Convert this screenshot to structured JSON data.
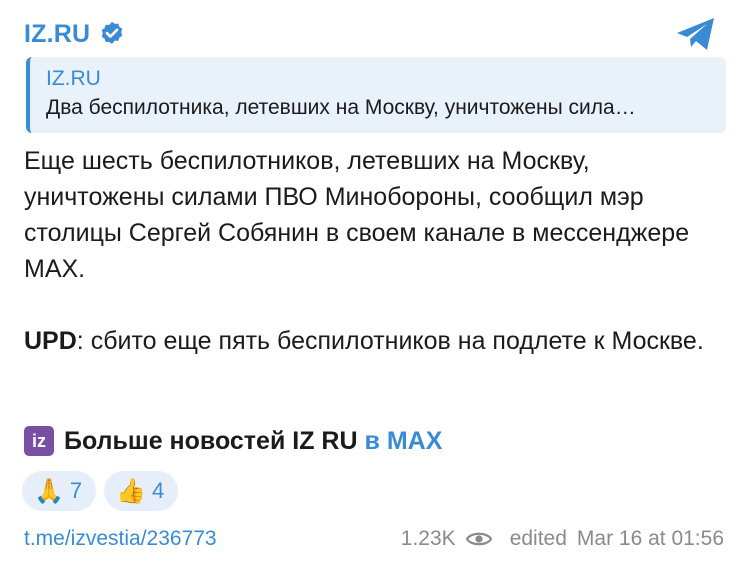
{
  "channel": {
    "name": "IZ.RU",
    "verified_icon": "verified-badge-icon",
    "share_icon": "telegram-share-icon",
    "accent_color": "#3a8bd6"
  },
  "quote": {
    "title": "IZ.RU",
    "text": "Два беспилотника, летевших на Москву, уничтожены сила…"
  },
  "message": {
    "paragraph1": "Еще шесть беспилотников, летевших на Москву, уничтожены силами ПВО Минобороны, сообщил мэр столицы Сергей Собянин в своем канале в мессенджере MAX.",
    "upd_label": "UPD",
    "upd_text": ": сбито еще пять беспилотников на подлете к Москве."
  },
  "more_news": {
    "logo_text": "iz",
    "label": "Больше новостей IZ RU",
    "link_text": "в MAX"
  },
  "reactions": [
    {
      "emoji": "🙏",
      "count": "7",
      "icon": "folded-hands-icon"
    },
    {
      "emoji": "👍",
      "count": "4",
      "icon": "thumbs-up-icon"
    }
  ],
  "footer": {
    "link": "t.me/izvestia/236773",
    "views": "1.23K",
    "views_icon": "eye-icon",
    "edited_label": "edited",
    "timestamp": "Mar 16 at 01:56"
  }
}
